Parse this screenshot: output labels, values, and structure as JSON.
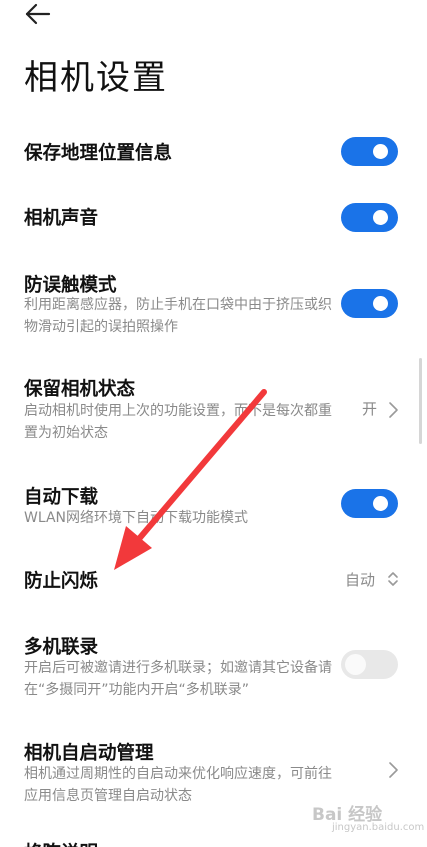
{
  "header": {
    "back_icon": "arrow-left-icon",
    "title": "相机设置"
  },
  "colors": {
    "accent": "#1a73e8",
    "toggle_off": "#e8e8e8",
    "annotation_arrow": "#f2393b"
  },
  "settings": [
    {
      "title": "保存地理位置信息",
      "control": "toggle",
      "on": true
    },
    {
      "title": "相机声音",
      "control": "toggle",
      "on": true
    },
    {
      "title": "防误触模式",
      "desc": "利用距离感应器，防止手机在口袋中由于挤压或织物滑动引起的误拍照操作",
      "control": "toggle",
      "on": true
    },
    {
      "title": "保留相机状态",
      "desc": "启动相机时使用上次的功能设置，而不是每次都重置为初始状态",
      "control": "value",
      "value": "开"
    },
    {
      "title": "自动下载",
      "desc": "WLAN网络环境下自动下载功能模式",
      "control": "toggle",
      "on": true
    },
    {
      "title": "防止闪烁",
      "control": "select",
      "value": "自动"
    },
    {
      "title": "多机联录",
      "desc": "开启后可被邀请进行多机联录；如邀请其它设备请在“多摄同开”功能内开启“多机联录”",
      "control": "toggle",
      "on": false
    },
    {
      "title": "相机自启动管理",
      "desc": "相机通过周期性的自启动来优化响应速度，可前往应用信息页管理自启动状态",
      "control": "chevron"
    },
    {
      "title": "格陈说明"
    }
  ],
  "watermark": {
    "text": "Bai 经验",
    "url": "jingyan.baidu.com"
  }
}
